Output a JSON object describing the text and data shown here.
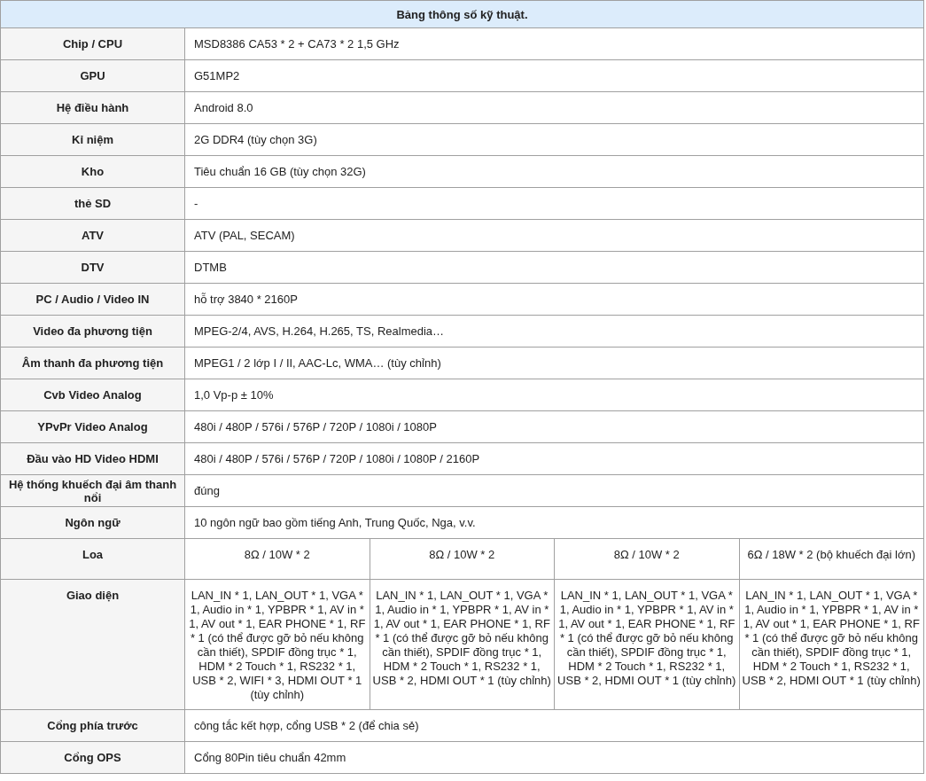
{
  "table": {
    "title": "Bảng thông số kỹ thuật.",
    "rows": [
      {
        "label": "Chip / CPU",
        "values": [
          "MSD8386 CA53 * 2 + CA73 * 2 1,5 GHz"
        ]
      },
      {
        "label": "GPU",
        "values": [
          "G51MP2"
        ]
      },
      {
        "label": "Hệ điều hành",
        "values": [
          "Android 8.0"
        ]
      },
      {
        "label": "Kỉ niệm",
        "values": [
          "2G DDR4 (tùy chọn 3G)"
        ]
      },
      {
        "label": "Kho",
        "values": [
          "Tiêu chuẩn 16 GB (tùy chọn 32G)"
        ]
      },
      {
        "label": "thẻ SD",
        "values": [
          "-"
        ]
      },
      {
        "label": "ATV",
        "values": [
          "ATV (PAL, SECAM)"
        ]
      },
      {
        "label": "DTV",
        "values": [
          "DTMB"
        ]
      },
      {
        "label": "PC / Audio / Video IN",
        "values": [
          "hỗ trợ 3840 * 2160P"
        ]
      },
      {
        "label": "Video đa phương tiện",
        "values": [
          "MPEG-2/4, AVS, H.264, H.265, TS, Realmedia…"
        ]
      },
      {
        "label": "Âm thanh đa phương tiện",
        "values": [
          "MPEG1 / 2 lớp I / II, AAC-Lc, WMA… (tùy chỉnh)"
        ]
      },
      {
        "label": "Cvb Video Analog",
        "values": [
          "1,0 Vp-p ± 10%"
        ]
      },
      {
        "label": "YPvPr Video Analog",
        "values": [
          "480i / 480P / 576i / 576P / 720P / 1080i / 1080P"
        ]
      },
      {
        "label": "Đầu vào HD Video HDMI",
        "values": [
          "480i / 480P / 576i / 576P / 720P / 1080i / 1080P / 2160P"
        ]
      },
      {
        "label": "Hệ thống khuếch đại âm thanh nổi",
        "values": [
          "đúng"
        ]
      },
      {
        "label": "Ngôn ngữ",
        "values": [
          "10 ngôn ngữ bao gồm tiếng Anh, Trung Quốc, Nga, v.v."
        ]
      },
      {
        "label": "Loa",
        "values": [
          "8Ω / 10W * 2",
          "8Ω / 10W * 2",
          "8Ω / 10W * 2",
          "6Ω / 18W * 2 (bộ khuếch đại lớn)"
        ]
      },
      {
        "label": "Giao diện",
        "values": [
          "LAN_IN * 1, LAN_OUT * 1, VGA * 1, Audio in * 1, YPBPR * 1, AV in * 1, AV out * 1, EAR PHONE * 1, RF * 1 (có thể được gỡ bỏ nếu không cần thiết), SPDIF đồng trục * 1, HDM * 2 Touch * 1, RS232 * 1, USB * 2, WIFI * 3, HDMI OUT * 1 (tùy chỉnh)",
          "LAN_IN * 1, LAN_OUT * 1, VGA * 1, Audio in * 1, YPBPR * 1, AV in * 1, AV out * 1, EAR PHONE * 1, RF * 1 (có thể được gỡ bỏ nếu không cần thiết), SPDIF đồng trục * 1, HDM * 2 Touch * 1, RS232 * 1, USB * 2, HDMI OUT * 1 (tùy chỉnh)",
          "LAN_IN * 1, LAN_OUT * 1, VGA * 1, Audio in * 1, YPBPR * 1, AV in * 1, AV out * 1, EAR PHONE * 1, RF * 1 (có thể được gỡ bỏ nếu không cần thiết), SPDIF đồng trục * 1, HDM * 2 Touch * 1, RS232 * 1, USB * 2, HDMI OUT * 1 (tùy chỉnh)",
          "LAN_IN * 1, LAN_OUT * 1, VGA * 1, Audio in * 1, YPBPR * 1, AV in * 1, AV out * 1, EAR PHONE * 1, RF * 1 (có thể được gỡ bỏ nếu không cần thiết), SPDIF đồng trục * 1, HDM * 2 Touch * 1, RS232 * 1, USB * 2, HDMI OUT * 1 (tùy chỉnh)"
        ]
      },
      {
        "label": "Cổng phía trước",
        "values": [
          "công tắc kết hợp, cổng USB * 2 (để chia sẻ)"
        ]
      },
      {
        "label": "Cổng OPS",
        "values": [
          "Cổng 80Pin tiêu chuẩn 42mm"
        ]
      }
    ]
  }
}
